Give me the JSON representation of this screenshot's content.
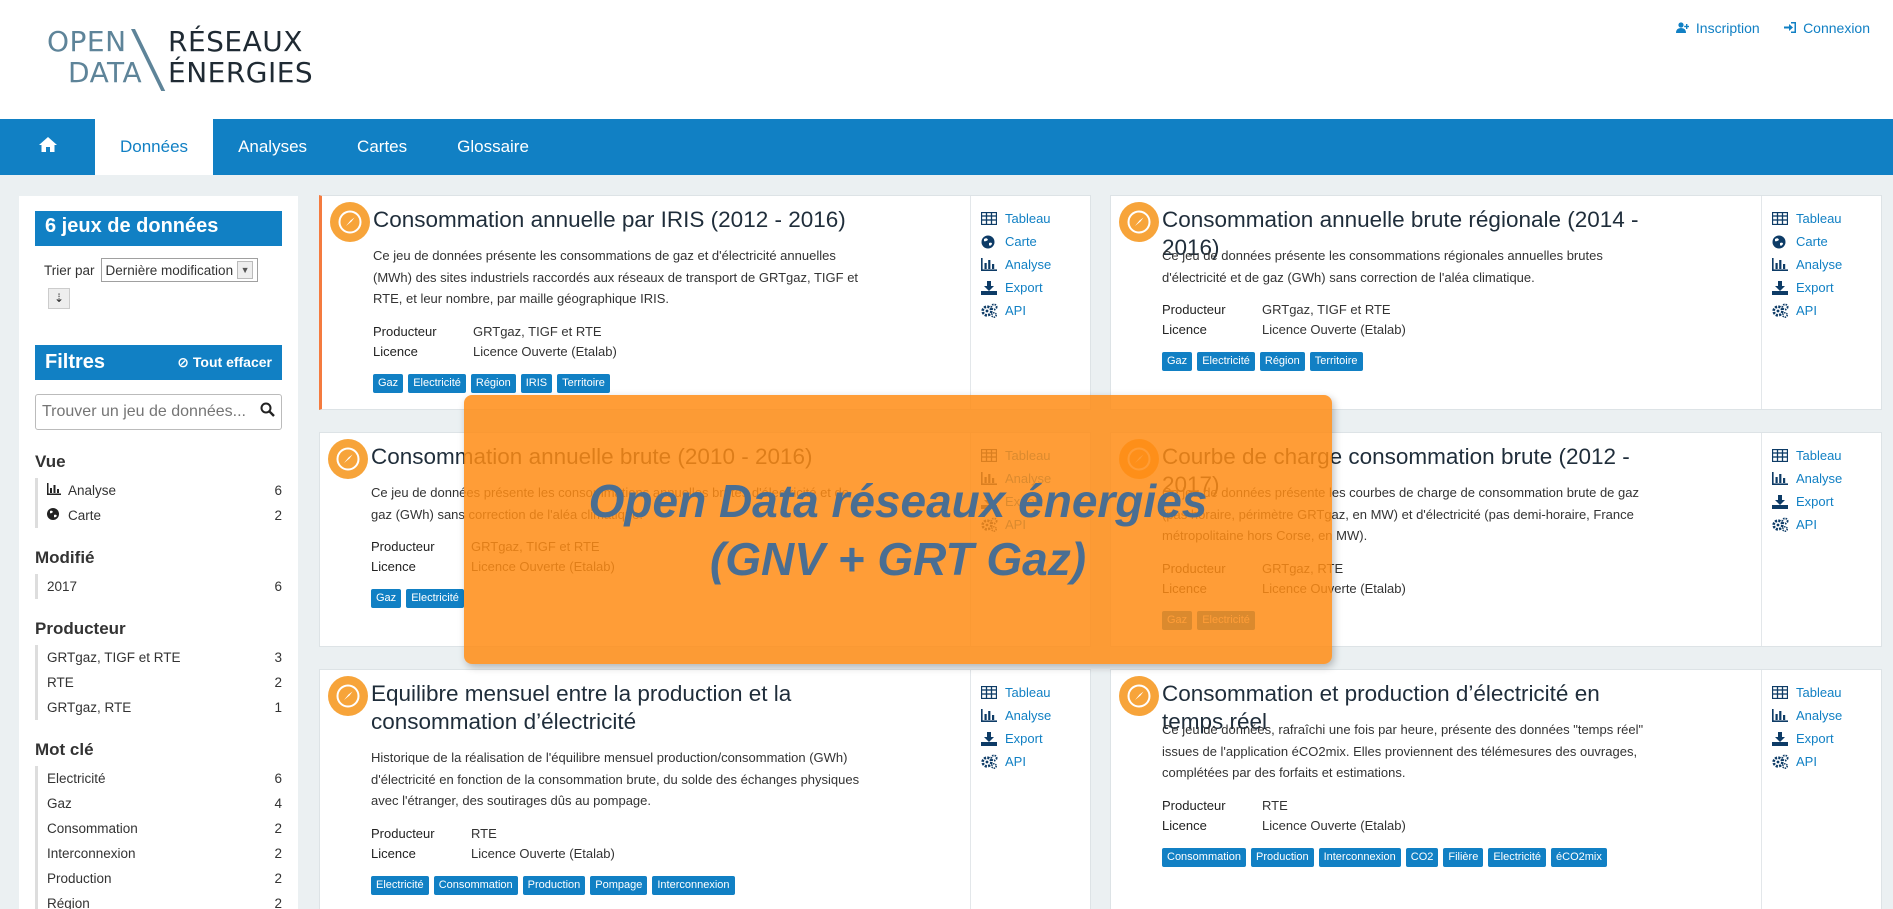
{
  "logo": {
    "left_line1": "OPEN",
    "left_line2": "DATA",
    "right_line1": "RÉSEAUX",
    "right_line2": "ÉNERGIES"
  },
  "auth": {
    "signup": "Inscription",
    "login": "Connexion"
  },
  "nav": {
    "items": [
      "Données",
      "Analyses",
      "Cartes",
      "Glossaire"
    ],
    "active": "Données"
  },
  "sidebar": {
    "count_label": "6 jeux de données",
    "sort_label": "Trier par",
    "sort_value": "Dernière modification",
    "filters_label": "Filtres",
    "clear_label": "Tout effacer",
    "search_placeholder": "Trouver un jeu de données...",
    "facets": [
      {
        "title": "Vue",
        "items": [
          {
            "label": "Analyse",
            "count": "6",
            "icon": "bar-chart-icon"
          },
          {
            "label": "Carte",
            "count": "2",
            "icon": "globe-icon"
          }
        ]
      },
      {
        "title": "Modifié",
        "items": [
          {
            "label": "2017",
            "count": "6"
          }
        ]
      },
      {
        "title": "Producteur",
        "items": [
          {
            "label": "GRTgaz, TIGF et RTE",
            "count": "3"
          },
          {
            "label": "RTE",
            "count": "2"
          },
          {
            "label": "GRTgaz, RTE",
            "count": "1"
          }
        ]
      },
      {
        "title": "Mot clé",
        "items": [
          {
            "label": "Electricité",
            "count": "6"
          },
          {
            "label": "Gaz",
            "count": "4"
          },
          {
            "label": "Consommation",
            "count": "2"
          },
          {
            "label": "Interconnexion",
            "count": "2"
          },
          {
            "label": "Production",
            "count": "2"
          },
          {
            "label": "Région",
            "count": "2"
          }
        ]
      }
    ]
  },
  "meta_labels": {
    "producer": "Producteur",
    "licence": "Licence"
  },
  "datasets": [
    {
      "title": "Consommation annuelle par IRIS (2012 - 2016)",
      "description": "Ce jeu de données présente les consommations de gaz et d'électricité annuelles (MWh) des sites industriels raccordés aux réseaux de transport de GRTgaz, TIGF et RTE, et leur nombre, par maille géographique IRIS.",
      "producer": "GRTgaz, TIGF et RTE",
      "licence": "Licence Ouverte (Etalab)",
      "tags": [
        "Gaz",
        "Electricité",
        "Région",
        "IRIS",
        "Territoire"
      ],
      "actions": [
        "Tableau",
        "Carte",
        "Analyse",
        "Export",
        "API"
      ]
    },
    {
      "title": "Consommation annuelle brute régionale (2014 - 2016)",
      "description": "Ce jeu de données présente les consommations régionales annuelles brutes d'électricité et de gaz (GWh) sans correction de l'aléa climatique.",
      "producer": "GRTgaz, TIGF et RTE",
      "licence": "Licence Ouverte (Etalab)",
      "tags": [
        "Gaz",
        "Electricité",
        "Région",
        "Territoire"
      ],
      "actions": [
        "Tableau",
        "Carte",
        "Analyse",
        "Export",
        "API"
      ]
    },
    {
      "title": "Consommation annuelle brute (2010 - 2016)",
      "description": "Ce jeu de données présente les consommations annuelles brutes d'électricité et de gaz (GWh) sans correction de l'aléa climatique.",
      "producer": "GRTgaz, TIGF et RTE",
      "licence": "Licence Ouverte (Etalab)",
      "tags": [
        "Gaz",
        "Electricité"
      ],
      "actions": [
        "Tableau",
        "Analyse",
        "Export",
        "API"
      ]
    },
    {
      "title": "Courbe de charge consommation brute (2012 - 2017)",
      "description": "Ce jeu de données présente les courbes de charge de consommation brute de gaz (pas horaire, périmètre GRTgaz, en MW) et d'électricité (pas demi-horaire, France métropolitaine hors Corse, en MW).",
      "producer": "GRTgaz, RTE",
      "licence": "Licence Ouverte (Etalab)",
      "tags": [
        "Gaz",
        "Electricité"
      ],
      "actions": [
        "Tableau",
        "Analyse",
        "Export",
        "API"
      ]
    },
    {
      "title": "Equilibre mensuel entre la production et la consommation d’électricité",
      "description": "Historique de la réalisation de l'équilibre mensuel production/consommation (GWh) d'électricité en fonction de la consommation brute, du solde des échanges physiques avec l'étranger, des soutirages dûs au pompage.",
      "producer": "RTE",
      "licence": "Licence Ouverte (Etalab)",
      "tags": [
        "Electricité",
        "Consommation",
        "Production",
        "Pompage",
        "Interconnexion"
      ],
      "actions": [
        "Tableau",
        "Analyse",
        "Export",
        "API"
      ]
    },
    {
      "title": "Consommation et production d’électricité en temps réel",
      "description": "Ce jeu de données, rafraîchi une fois par heure, présente des données \"temps réel\" issues de l'application éCO2mix. Elles proviennent des télémesures des ouvrages, complétées par des forfaits et estimations.",
      "producer": "RTE",
      "licence": "Licence Ouverte (Etalab)",
      "tags": [
        "Consommation",
        "Production",
        "Interconnexion",
        "CO2",
        "Filière",
        "Electricité",
        "éCO2mix"
      ],
      "actions": [
        "Tableau",
        "Analyse",
        "Export",
        "API"
      ]
    }
  ],
  "overlay": {
    "line1": "Open Data réseaux énergies",
    "line2": "(GNV + GRT Gaz)"
  }
}
